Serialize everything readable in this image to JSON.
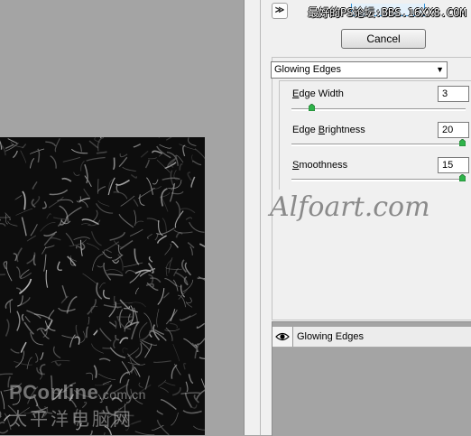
{
  "preview": {
    "watermark_brand": "PConline",
    "watermark_domain": ".com.cn",
    "watermark_chinese": "太平洋电脑网"
  },
  "header": {
    "site_watermark": "最好的PS论坛:BBS.16XX8.COM"
  },
  "buttons": {
    "cancel": "Cancel"
  },
  "filter": {
    "selected": "Glowing Edges",
    "params": [
      {
        "label_prefix": "",
        "label_underline": "E",
        "label_rest": "dge Width",
        "value": "3",
        "level": 0.1
      },
      {
        "label_prefix": "Edge ",
        "label_underline": "B",
        "label_rest": "rightness",
        "value": "20",
        "level": 1.0
      },
      {
        "label_prefix": "",
        "label_underline": "S",
        "label_rest": "moothness",
        "value": "15",
        "level": 1.0
      }
    ]
  },
  "overlay": {
    "alfoart": "Alfoart.com"
  },
  "layers": {
    "items": [
      {
        "name": "Glowing Edges"
      }
    ]
  }
}
